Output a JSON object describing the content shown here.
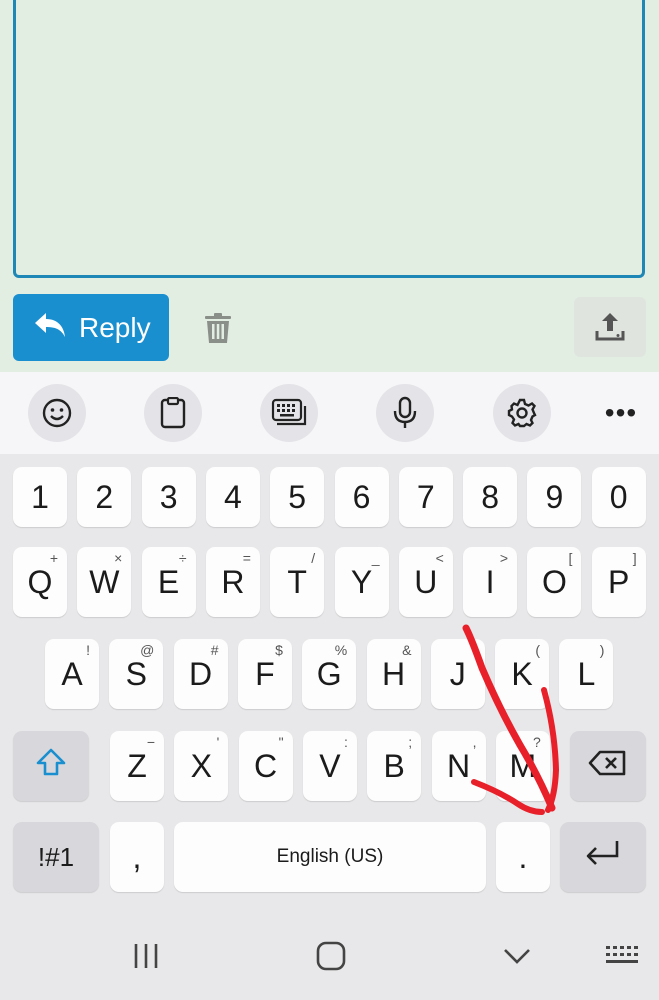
{
  "compose": {
    "reply_label": "Reply",
    "reply_icon": "reply-arrow-icon",
    "trash_icon": "trash-icon",
    "upload_icon": "upload-icon"
  },
  "toolbar": {
    "items": [
      "emoji-icon",
      "clipboard-icon",
      "keyboard-mode-icon",
      "microphone-icon",
      "settings-icon"
    ],
    "more_label": "•••"
  },
  "keyboard": {
    "row_numbers": [
      "1",
      "2",
      "3",
      "4",
      "5",
      "6",
      "7",
      "8",
      "9",
      "0"
    ],
    "row_q": [
      {
        "key": "Q",
        "hint": "+"
      },
      {
        "key": "W",
        "hint": "×"
      },
      {
        "key": "E",
        "hint": "÷"
      },
      {
        "key": "R",
        "hint": "="
      },
      {
        "key": "T",
        "hint": "/"
      },
      {
        "key": "Y",
        "hint": "_"
      },
      {
        "key": "U",
        "hint": "<"
      },
      {
        "key": "I",
        "hint": ">"
      },
      {
        "key": "O",
        "hint": "["
      },
      {
        "key": "P",
        "hint": "]"
      }
    ],
    "row_a": [
      {
        "key": "A",
        "hint": "!"
      },
      {
        "key": "S",
        "hint": "@"
      },
      {
        "key": "D",
        "hint": "#"
      },
      {
        "key": "F",
        "hint": "$"
      },
      {
        "key": "G",
        "hint": "%"
      },
      {
        "key": "H",
        "hint": "&"
      },
      {
        "key": "J",
        "hint": ""
      },
      {
        "key": "K",
        "hint": "("
      },
      {
        "key": "L",
        "hint": ")"
      }
    ],
    "row_z": [
      {
        "key": "Z",
        "hint": "−"
      },
      {
        "key": "X",
        "hint": "'"
      },
      {
        "key": "C",
        "hint": "\""
      },
      {
        "key": "V",
        "hint": ":"
      },
      {
        "key": "B",
        "hint": ";"
      },
      {
        "key": "N",
        "hint": ","
      },
      {
        "key": "M",
        "hint": "?"
      }
    ],
    "symbols_label": "!#1",
    "comma_label": ",",
    "space_label": "English (US)",
    "period_label": ".",
    "shift_icon": "shift-icon",
    "backspace_icon": "backspace-icon",
    "enter_icon": "enter-icon"
  },
  "navbar": {
    "items": [
      "recent-apps-icon",
      "home-icon",
      "back-icon",
      "keyboard-switch-icon"
    ]
  },
  "colors": {
    "accent": "#1a8fd0",
    "compose_bg": "#e3eee3",
    "border": "#1f87b5",
    "scribble": "#e8202a"
  }
}
